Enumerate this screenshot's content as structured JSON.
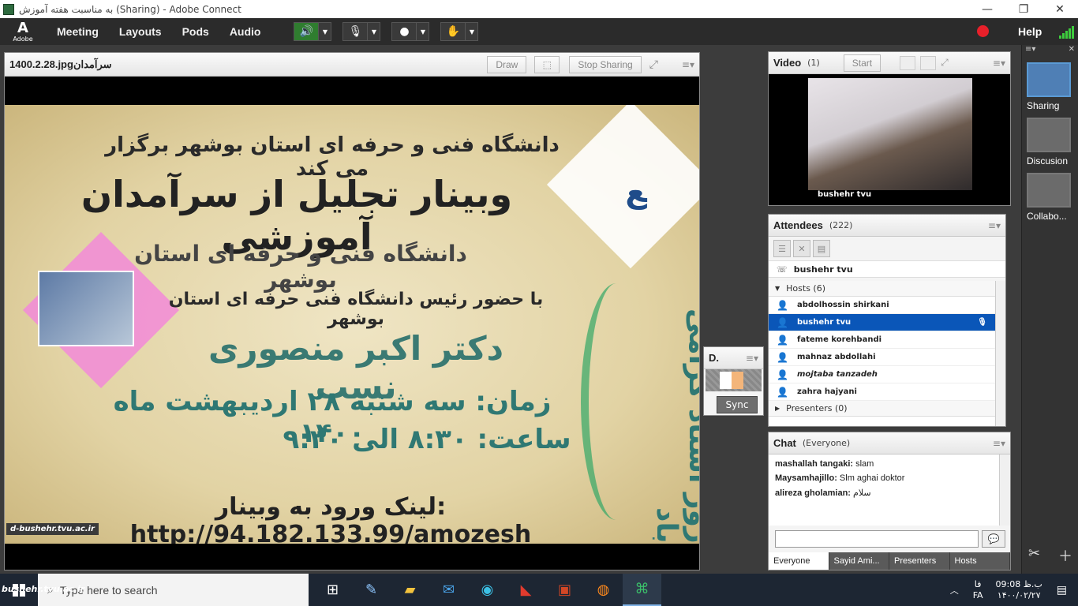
{
  "window": {
    "title": "به مناسبت هفته آموزش (Sharing) - Adobe Connect",
    "minimize": "—",
    "maximize": "❐",
    "close": "✕"
  },
  "menubar": {
    "adobe_label": "Adobe",
    "items": [
      "Meeting",
      "Layouts",
      "Pods",
      "Audio"
    ],
    "help": "Help"
  },
  "share": {
    "file_name": "1400.2.28.jpgسرآمدان",
    "draw_label": "Draw",
    "stop_sharing_label": "Stop Sharing"
  },
  "slide": {
    "line1": "دانشگاه فنی و حرفه ای استان بوشهر برگزار می کند",
    "line2": "وبینار تجلیل از سرآمدان آموزشی",
    "line3": "دانشگاه فنی و حرفه ای استان بوشهر",
    "line4": "با حضور رئیس دانشگاه فنی حرفه ای استان بوشهر",
    "line5": "دکتر اکبر منصوری نسب",
    "line6": "زمان: سه شنبه ۲۸ اردیبهشت ماه ۱۴۰۰",
    "line7": "ساعت: ۸:۳۰ الی ۹:۳۰",
    "line8": "لینک ورود به وبینار: http://94.182.133.99/amozesh",
    "vertical": "روز استاد گرامی باد",
    "watermark": "d-bushehr.tvu.ac.ir"
  },
  "video": {
    "title": "Video",
    "count": "(1)",
    "start_label": "Start",
    "name": "bushehr tvu"
  },
  "attendees": {
    "title": "Attendees",
    "count": "(222)",
    "me": "bushehr tvu",
    "hosts_label": "Hosts (6)",
    "hosts": [
      {
        "name": "abdolhossin shirkani",
        "selected": false
      },
      {
        "name": "bushehr tvu",
        "selected": true
      },
      {
        "name": "fateme korehbandi",
        "selected": false
      },
      {
        "name": "mahnaz abdollahi",
        "selected": false
      },
      {
        "name": "mojtaba tanzadeh",
        "selected": false
      },
      {
        "name": "zahra hajyani",
        "selected": false
      }
    ],
    "presenters_label": "Presenters (0)"
  },
  "dpod": {
    "title": "D.",
    "sync_label": "Sync"
  },
  "chat": {
    "title": "Chat",
    "scope": "(Everyone)",
    "messages": [
      {
        "sender": "mashallah tangaki:",
        "text": "slam"
      },
      {
        "sender": "Maysamhajillo:",
        "text": "Slm aghai doktor"
      },
      {
        "sender": "alireza gholamian:",
        "text": "سلام"
      }
    ],
    "tabs": [
      "Everyone",
      "Sayid Ami...",
      "Presenters",
      "Hosts"
    ]
  },
  "layouts": [
    {
      "label": "Sharing",
      "active": true
    },
    {
      "label": "Discusion",
      "active": false
    },
    {
      "label": "Collabo...",
      "active": false
    }
  ],
  "taskbar": {
    "search_placeholder": "Type here to search",
    "overlay": "bushehr.tvu.ac.ir",
    "lang1": "فا",
    "lang2": "FA",
    "time": "09:08 ب.ظ",
    "date": "۱۴۰۰/۰۲/۲۷"
  },
  "colors": {
    "accent_blue": "#0a56b8",
    "record_red": "#e8202a",
    "signal_green": "#3dcc3d",
    "slide_teal": "#2f7873"
  }
}
